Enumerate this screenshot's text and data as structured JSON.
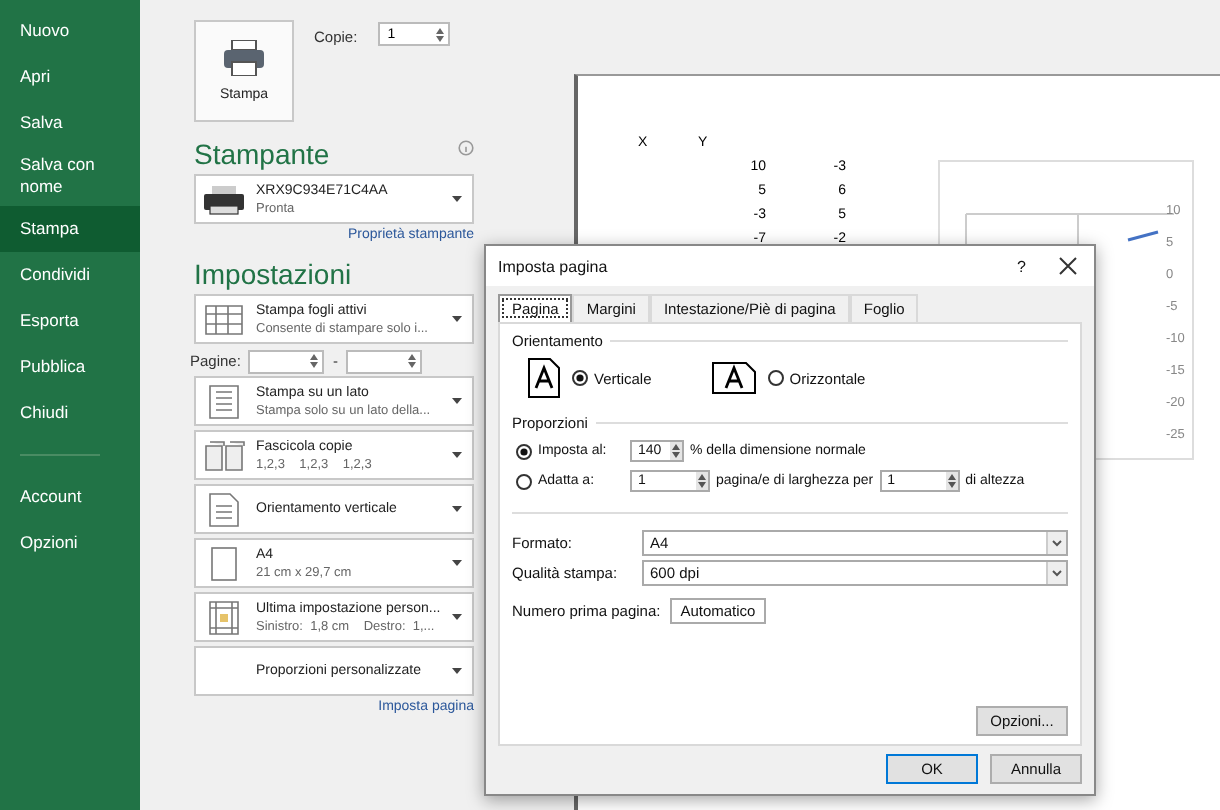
{
  "sidebar": {
    "items": [
      {
        "label": "Nuovo",
        "selected": false
      },
      {
        "label": "Apri",
        "selected": false
      },
      {
        "label": "Salva",
        "selected": false
      },
      {
        "label": "Salva con nome",
        "selected": false
      },
      {
        "label": "Stampa",
        "selected": true
      },
      {
        "label": "Condividi",
        "selected": false
      },
      {
        "label": "Esporta",
        "selected": false
      },
      {
        "label": "Pubblica",
        "selected": false
      },
      {
        "label": "Chiudi",
        "selected": false
      }
    ],
    "footer_items": [
      {
        "label": "Account",
        "selected": false
      },
      {
        "label": "Opzioni",
        "selected": false
      }
    ]
  },
  "print_panel": {
    "print_button": "Stampa",
    "copies_label": "Copie:",
    "copies_value": "1",
    "printer_heading": "Stampante",
    "printer": {
      "name": "XRX9C934E71C4AA",
      "status": "Pronta"
    },
    "printer_properties_link": "Proprietà stampante",
    "settings_heading": "Impostazioni",
    "settings": [
      {
        "kind": "dropdown",
        "title": "Stampa fogli attivi",
        "subtitle": "Consente di stampare solo i..."
      },
      {
        "kind": "pages",
        "label": "Pagine:",
        "separator": "-"
      },
      {
        "kind": "dropdown",
        "title": "Stampa su un lato",
        "subtitle": "Stampa solo su un lato della..."
      },
      {
        "kind": "dropdown",
        "title": "Fascicola copie",
        "subtitle": "1,2,3    1,2,3    1,2,3"
      },
      {
        "kind": "dropdown",
        "title": "Orientamento verticale"
      },
      {
        "kind": "dropdown",
        "title": "A4",
        "subtitle": "21 cm x 29,7 cm"
      },
      {
        "kind": "dropdown",
        "title": "Ultima impostazione person...",
        "subtitle": "Sinistro:  1,8 cm    Destro:  1,..."
      },
      {
        "kind": "dropdown",
        "title": "Proporzioni personalizzate"
      }
    ],
    "page_setup_link": "Imposta pagina"
  },
  "preview": {
    "table": {
      "headers": [
        "X",
        "Y"
      ],
      "rows": [
        [
          "10",
          "-3"
        ],
        [
          "5",
          "6"
        ],
        [
          "-3",
          "5"
        ],
        [
          "-7",
          "-2"
        ]
      ]
    },
    "chart": {
      "tick_labels": [
        "10",
        "5",
        "0",
        "-5",
        "-10",
        "-15",
        "-20",
        "-25"
      ]
    }
  },
  "dialog": {
    "title": "Imposta pagina",
    "help": "?",
    "tabs": [
      {
        "label": "Pagina",
        "selected": true
      },
      {
        "label": "Margini",
        "selected": false
      },
      {
        "label": "Intestazione/Piè di pagina",
        "selected": false
      },
      {
        "label": "Foglio",
        "selected": false
      }
    ],
    "orientation": {
      "legend": "Orientamento",
      "options": [
        {
          "label": "Verticale",
          "selected": true
        },
        {
          "label": "Orizzontale",
          "selected": false
        }
      ]
    },
    "scaling": {
      "legend": "Proporzioni",
      "adjust": {
        "label": "Imposta al:",
        "selected": true,
        "value": "140",
        "suffix": "% della dimensione normale"
      },
      "fit": {
        "label": "Adatta a:",
        "selected": false,
        "width_value": "1",
        "middle": "pagina/e di larghezza per",
        "height_value": "1",
        "suffix": "di altezza"
      }
    },
    "paper_size": {
      "label": "Formato:",
      "value": "A4"
    },
    "print_quality": {
      "label": "Qualità stampa:",
      "value": "600 dpi"
    },
    "first_page_number": {
      "label": "Numero prima pagina:",
      "value": "Automatico"
    },
    "options_button": "Opzioni...",
    "buttons": [
      "OK",
      "Annulla"
    ]
  }
}
